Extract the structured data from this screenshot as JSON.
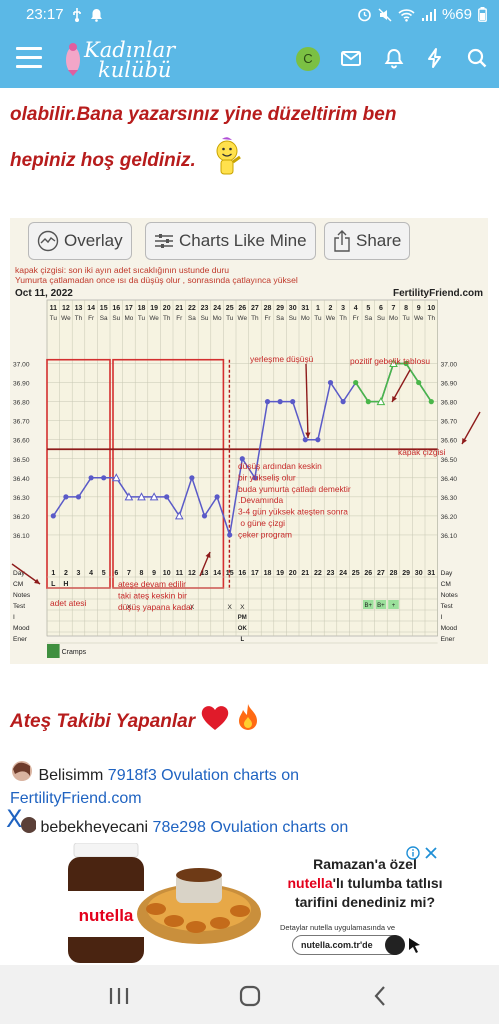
{
  "status_bar": {
    "time": "23:17",
    "battery": "%69"
  },
  "app_bar": {
    "logo_line1": "Kadınlar",
    "logo_line2": "kulübü",
    "avatar_letter": "C"
  },
  "post": {
    "line1": "olabilir.Bana yazarsınız yine düzeltirim ben",
    "line2": "hepiniz hoş geldiniz."
  },
  "chart_image": {
    "toolbar": {
      "overlay": "Overlay",
      "charts_like_mine": "Charts Like Mine",
      "share": "Share"
    },
    "note_line1": "kapak çizgisi: son iki ayın adet sıcaklığının ustunde duru",
    "note_line2": "Yumurta çatlamadan once ısı da düşüş olur , sonrasında çatlayınca yüksel",
    "date": "Oct 11, 2022",
    "brand": "FertilityFriend.com",
    "dates": [
      "11",
      "12",
      "13",
      "14",
      "15",
      "16",
      "17",
      "18",
      "19",
      "20",
      "21",
      "22",
      "23",
      "24",
      "25",
      "26",
      "27",
      "28",
      "29",
      "30",
      "31",
      "1",
      "2",
      "3",
      "4",
      "5",
      "6",
      "7",
      "8",
      "9",
      "10"
    ],
    "weekdays": [
      "Tu",
      "We",
      "Th",
      "Fr",
      "Sa",
      "Su",
      "Mo",
      "Tu",
      "We",
      "Th",
      "Fr",
      "Sa",
      "Su",
      "Mo",
      "Tu",
      "We",
      "Th",
      "Fr",
      "Sa",
      "Su",
      "Mo",
      "Tu",
      "We",
      "Th",
      "Fr",
      "Sa",
      "Su",
      "Mo",
      "Tu",
      "We",
      "Th"
    ],
    "temp_labels": [
      "37.00",
      "36.90",
      "36.80",
      "36.70",
      "36.60",
      "36.50",
      "36.40",
      "36.30",
      "36.20",
      "36.10"
    ],
    "temps": [
      36.2,
      36.3,
      36.3,
      36.4,
      36.4,
      36.4,
      36.3,
      36.3,
      36.3,
      36.3,
      36.2,
      36.4,
      36.2,
      36.3,
      36.1,
      36.5,
      36.4,
      36.8,
      36.8,
      36.8,
      36.6,
      36.6,
      36.9,
      36.8,
      36.9,
      36.8,
      36.8,
      37.0,
      37.0,
      36.9,
      36.8
    ],
    "cycle_days": [
      "1",
      "2",
      "3",
      "4",
      "5",
      "6",
      "7",
      "8",
      "9",
      "10",
      "11",
      "12",
      "13",
      "14",
      "15",
      "16",
      "17",
      "18",
      "19",
      "20",
      "21",
      "22",
      "23",
      "24",
      "25",
      "26",
      "27",
      "28",
      "29",
      "30",
      "31"
    ],
    "row_labels": {
      "day": "Day",
      "cm": "CM",
      "notes": "Notes",
      "test": "Test",
      "i": "I",
      "mood": "Mood",
      "ener": "Ener"
    },
    "cm_values": [
      "L",
      "H"
    ],
    "test_values": [
      "B+",
      "B+",
      "+"
    ],
    "pm_marks": [
      "PM",
      "OK",
      "L"
    ],
    "cramps": "Cramps",
    "annotations": {
      "implantation": "yerleşme düşüşü",
      "positive": "pozitif gebelik tablosu",
      "cover_line": "kapak çizgisi",
      "after_drop": "düşüş ardından keskin\nbir yükseliş olur\nbuda yumurta çatladı demektir\n.Devamında\n3-4 gün yüksek ateşten sonra\n o güne çizgi\nçeker program",
      "period_temp": "adet atesi",
      "continue": "ateşe devam edilir\ntaki ateş keskin bir\ndüşüş yapana kadar"
    }
  },
  "section": {
    "title": "Ateş Takibi Yapanlar"
  },
  "users": [
    {
      "name": "Belisimm",
      "link": "7918f3 Ovulation charts on",
      "link_cont": "FertilityFriend.com"
    },
    {
      "name": "bebekheyecani",
      "link": "78e298 Ovulation charts on"
    }
  ],
  "ad": {
    "line1": "Ramazan'a özel",
    "brand": "nutella",
    "line2": "'lı tulumba tatlısı",
    "line3": "tarifini denediniz mi?",
    "details": "Detaylar nutella uygulamasında ve",
    "site": "nutella.com.tr'de",
    "jar_label": "nutella",
    "close_x": "X"
  },
  "colors": {
    "accent": "#5bb8e6",
    "post_text": "#b71c1c",
    "link": "#1f63c1",
    "series": "#5a5ac8",
    "annot_red": "#c62828"
  }
}
